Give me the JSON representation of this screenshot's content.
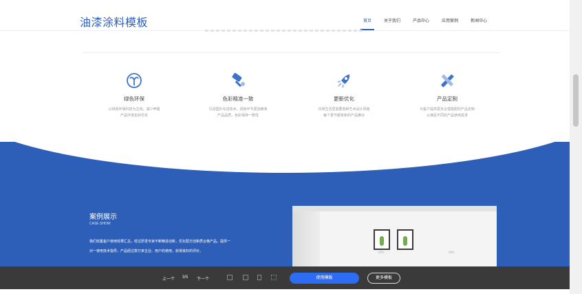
{
  "header": {
    "logo": "油漆涂料模板",
    "nav": [
      "首页",
      "关于我们",
      "产品中心",
      "应用案例",
      "新闻中心"
    ]
  },
  "features": [
    {
      "icon": "leaf-icon",
      "title": "绿色环保",
      "desc1": "以绿色环保科技为主线，减少甲醛",
      "desc2": "产品环境友好优化"
    },
    {
      "icon": "paint-roller-icon",
      "title": "色彩精准一致",
      "desc1": "引进国外先进技术，调色环节更加精准",
      "desc2": "产品品质，色彩保持一致性"
    },
    {
      "icon": "rocket-icon",
      "title": "更新优化",
      "desc1": "日常生活里需要各种艺术设计风格",
      "desc2": "每个季节都有新的产品推出"
    },
    {
      "icon": "pencil-ruler-icon",
      "title": "产品定制",
      "desc1": "为客户提供更多合理搭配的产品定制",
      "desc2": "以满足不同的产品使用需求"
    }
  ],
  "case": {
    "title": "案例展示",
    "subtitle": "CASE SHOW",
    "line1": "我们收集客户使用效果汇总，经过研发专家不断精进创新，优化配方创新质合格产品。提供一",
    "line2": "对一使用技术指导，产品经过数万家企业、用户的使用，获得良好的评价。"
  },
  "bottombar": {
    "prev": "上一个",
    "page": "3/5",
    "next": "下一个",
    "use_template": "使用模板",
    "more_templates": "更多模板"
  },
  "colors": {
    "brand": "#2d5fb8",
    "button": "#2d6df6",
    "bar": "#3a3a3a"
  }
}
